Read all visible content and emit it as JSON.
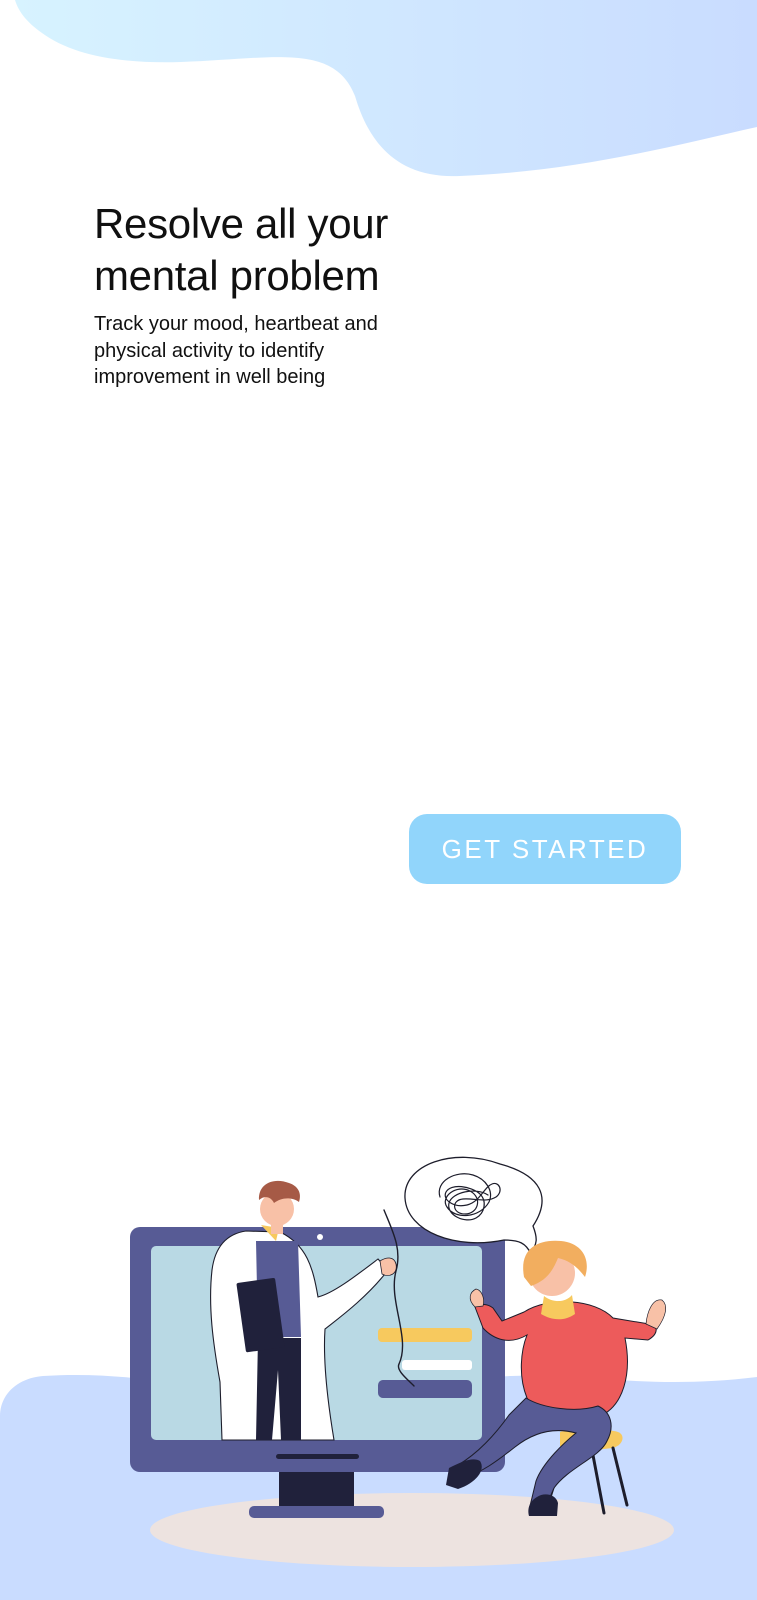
{
  "onboarding": {
    "title": "Resolve all your mental problem",
    "subtitle": "Track your mood, heartbeat and physical activity to identify improvement in well being",
    "cta_label": "GET STARTED"
  },
  "illustration": {
    "icon": "doctor-video-consultation-illustration"
  },
  "colors": {
    "top_blob_start": "#d7f3ff",
    "top_blob_end": "#c9dcff",
    "bottom_band": "#c9dcff",
    "button": "#91d5fb",
    "button_text": "#ffffff",
    "monitor_frame": "#575b95",
    "monitor_screen": "#b9d9e4",
    "floor_shadow": "#ede3e0",
    "accent_yellow": "#f7c95e",
    "accent_red": "#ed5b5b"
  }
}
